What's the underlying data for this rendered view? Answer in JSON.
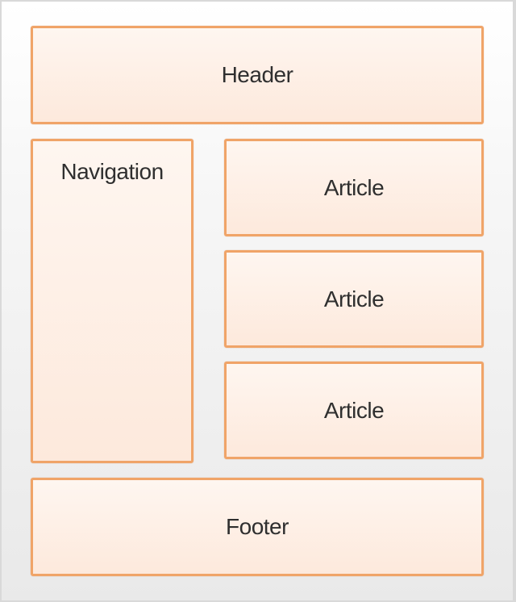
{
  "layout": {
    "header": "Header",
    "navigation": "Navigation",
    "articles": [
      "Article",
      "Article",
      "Article"
    ],
    "footer": "Footer"
  },
  "colors": {
    "box_border": "#f0a468",
    "box_fill_top": "#fef6f0",
    "box_fill_bottom": "#fde9dc",
    "background": "#f2f2f2",
    "text": "#2f2f2f"
  }
}
